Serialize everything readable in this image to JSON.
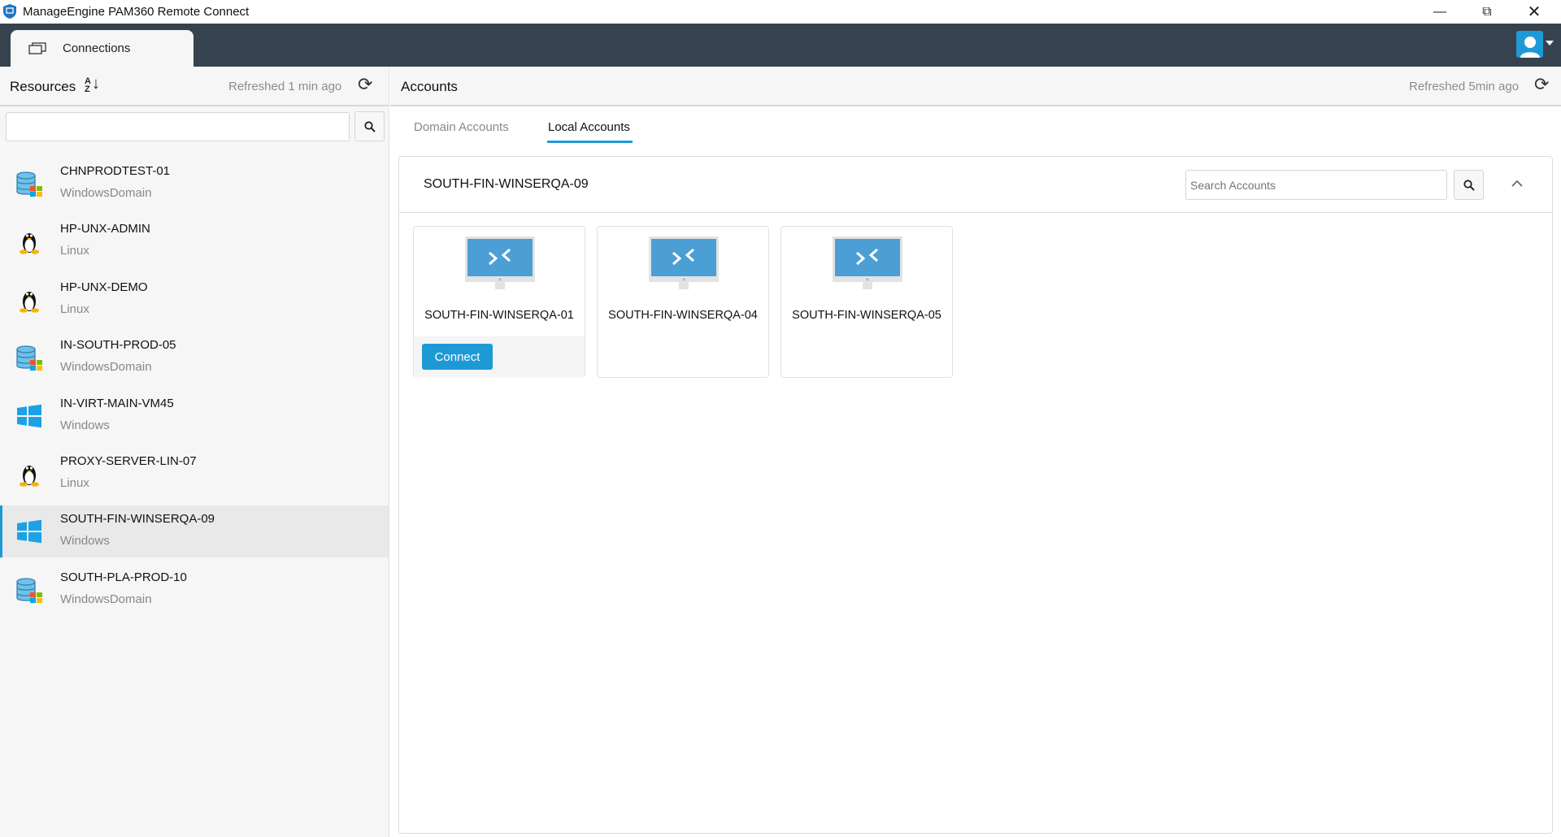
{
  "window": {
    "title": "ManageEngine PAM360 Remote Connect",
    "controls": [
      "minimize",
      "restore",
      "close"
    ]
  },
  "topbar": {
    "tab_label": "Connections"
  },
  "sidebar": {
    "title": "Resources",
    "refreshed": "Refreshed 1 min ago",
    "search_value": "",
    "items": [
      {
        "name": "CHNPRODTEST-01",
        "type": "WindowsDomain",
        "icon": "database-windows-icon"
      },
      {
        "name": "HP-UNX-ADMIN",
        "type": "Linux",
        "icon": "linux-icon"
      },
      {
        "name": "HP-UNX-DEMO",
        "type": "Linux",
        "icon": "linux-icon"
      },
      {
        "name": "IN-SOUTH-PROD-05",
        "type": "WindowsDomain",
        "icon": "database-windows-icon"
      },
      {
        "name": "IN-VIRT-MAIN-VM45",
        "type": "Windows",
        "icon": "windows-icon"
      },
      {
        "name": "PROXY-SERVER-LIN-07",
        "type": "Linux",
        "icon": "linux-icon"
      },
      {
        "name": "SOUTH-FIN-WINSERQA-09",
        "type": "Windows",
        "icon": "windows-icon",
        "selected": true
      },
      {
        "name": "SOUTH-PLA-PROD-10",
        "type": "WindowsDomain",
        "icon": "database-windows-icon"
      }
    ]
  },
  "main": {
    "title": "Accounts",
    "refreshed": "Refreshed 5min ago",
    "tabs": [
      {
        "label": "Domain Accounts"
      },
      {
        "label": "Local Accounts",
        "active": true
      }
    ],
    "panel": {
      "resource": "SOUTH-FIN-WINSERQA-09",
      "search_placeholder": "Search Accounts",
      "accounts": [
        {
          "name": "SOUTH-FIN-WINSERQA-01",
          "connect_label": "Connect"
        },
        {
          "name": "SOUTH-FIN-WINSERQA-04"
        },
        {
          "name": "SOUTH-FIN-WINSERQA-05"
        }
      ]
    }
  },
  "colors": {
    "accent": "#1d9ad6",
    "topbar": "#36434e",
    "sidebar_bg": "#f6f6f6"
  }
}
